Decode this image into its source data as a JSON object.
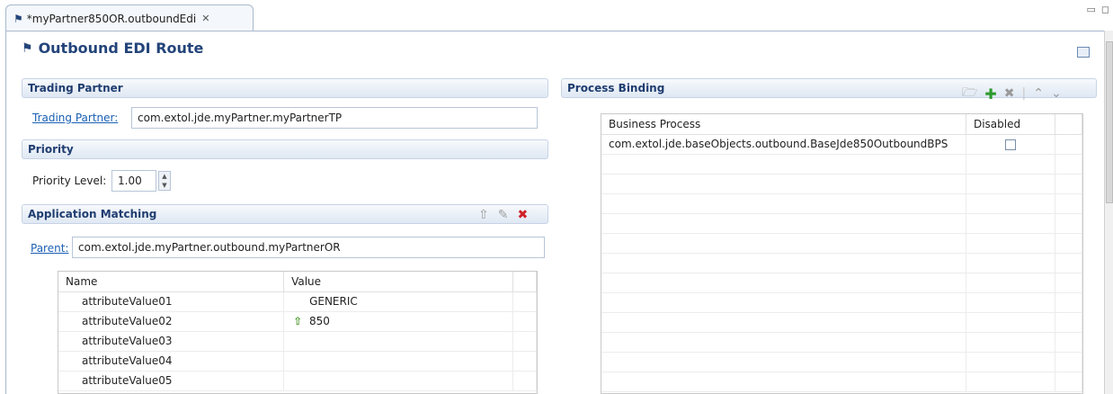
{
  "tab": {
    "title": "*myPartner850OR.outboundEdi",
    "close_glyph": "✕"
  },
  "form": {
    "title": "Outbound EDI Route"
  },
  "trading_partner": {
    "section": "Trading Partner",
    "label": "Trading Partner:",
    "value": "com.extol.jde.myPartner.myPartnerTP"
  },
  "priority": {
    "section": "Priority",
    "label": "Priority Level:",
    "value": "1.00"
  },
  "application_matching": {
    "section": "Application Matching",
    "parent_label": "Parent:",
    "parent_value": "com.extol.jde.myPartner.outbound.myPartnerOR",
    "columns": [
      "Name",
      "Value"
    ],
    "rows": [
      {
        "name": "attributeValue01",
        "value": "GENERIC",
        "inherited": false
      },
      {
        "name": "attributeValue02",
        "value": "850",
        "inherited": true
      },
      {
        "name": "attributeValue03",
        "value": "",
        "inherited": false
      },
      {
        "name": "attributeValue04",
        "value": "",
        "inherited": false
      },
      {
        "name": "attributeValue05",
        "value": "",
        "inherited": false
      }
    ]
  },
  "process_binding": {
    "section": "Process Binding",
    "columns": [
      "Business Process",
      "Disabled"
    ],
    "rows": [
      {
        "process": "com.extol.jde.baseObjects.outbound.BaseJde850OutboundBPS",
        "disabled": false
      }
    ],
    "empty_rows": 12
  }
}
